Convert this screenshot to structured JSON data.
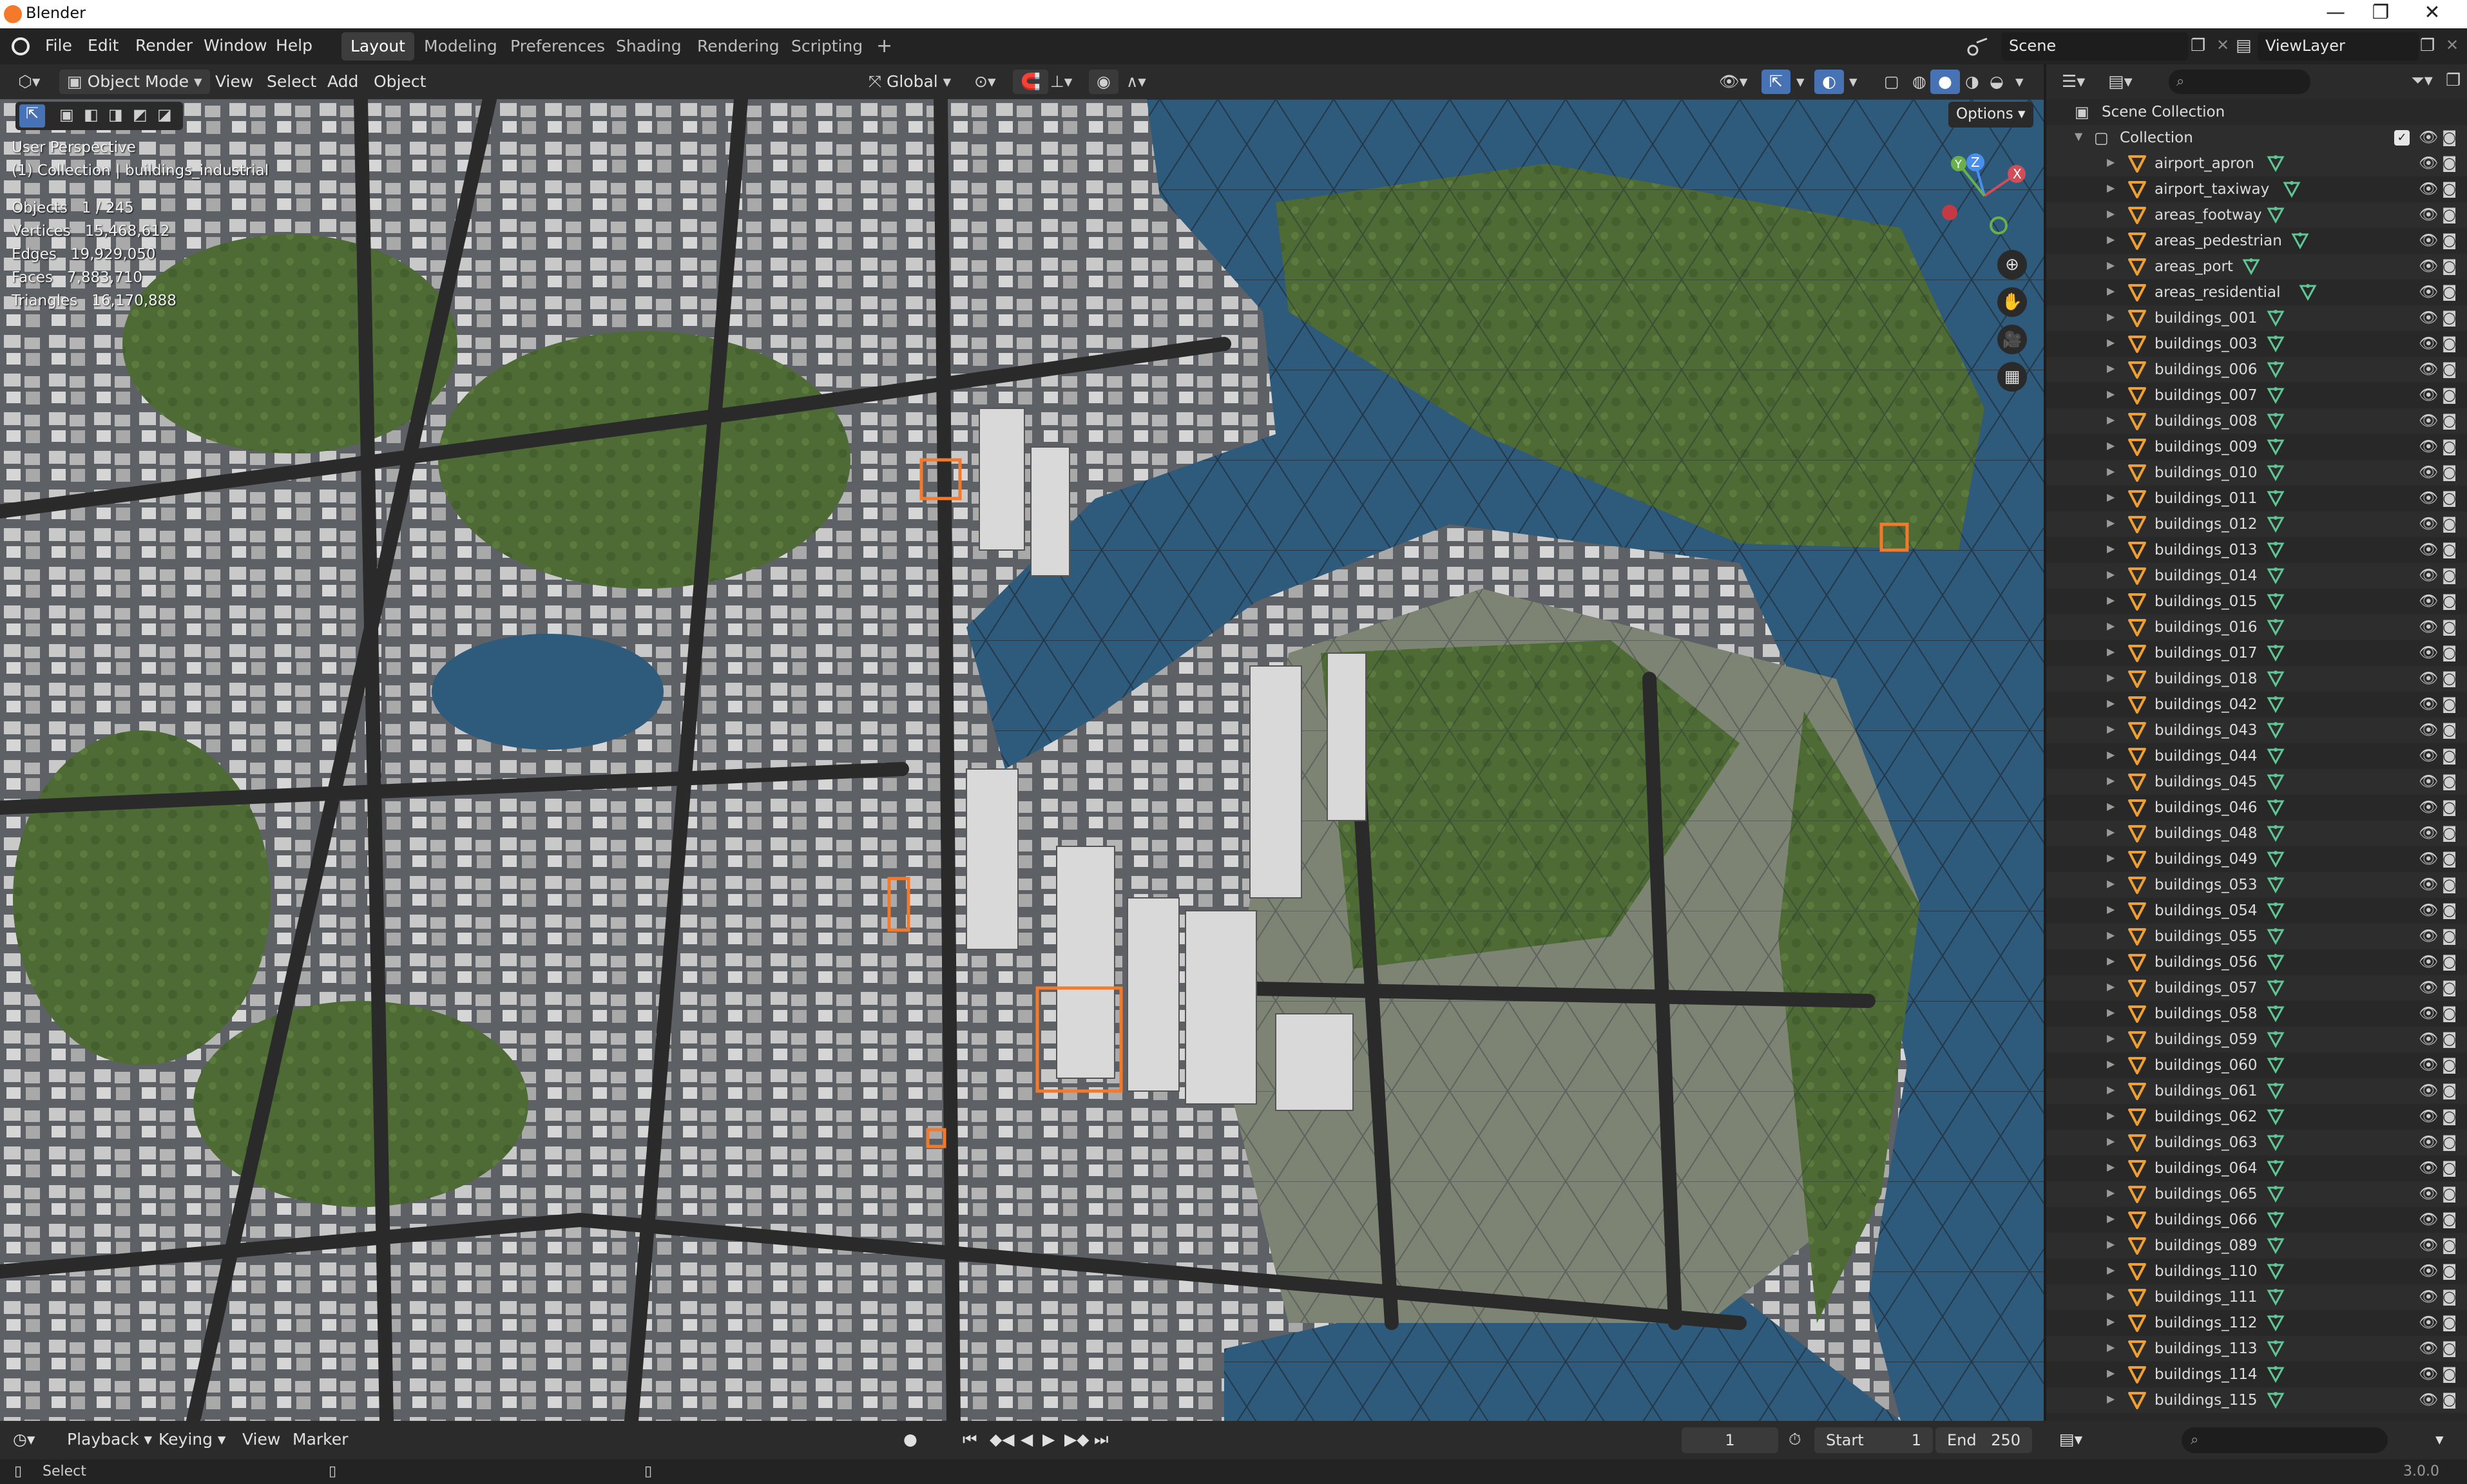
{
  "window": {
    "title": "Blender",
    "minimize": "—",
    "maximize": "❐",
    "close": "✕"
  },
  "menu": [
    "File",
    "Edit",
    "Render",
    "Window",
    "Help"
  ],
  "workspaces": [
    "Layout",
    "Modeling",
    "Preferences",
    "Shading",
    "Rendering",
    "Scripting"
  ],
  "add_workspace": "+",
  "scene": {
    "scene_name": "Scene",
    "view_layer": "ViewLayer"
  },
  "viewport_header": {
    "mode": "Object Mode",
    "items": [
      "View",
      "Select",
      "Add",
      "Object"
    ],
    "orientation": "Global",
    "options": "Options"
  },
  "viewport": {
    "perspective": "User Perspective",
    "context": "(1) Collection | buildings_industrial",
    "stats": [
      {
        "label": "Objects",
        "value": "1 / 245"
      },
      {
        "label": "Vertices",
        "value": "15,468,612"
      },
      {
        "label": "Edges",
        "value": "19,929,050"
      },
      {
        "label": "Faces",
        "value": "7,883,710"
      },
      {
        "label": "Triangles",
        "value": "16,170,888"
      }
    ],
    "gizmo": {
      "x": "X",
      "y": "Y",
      "z": "Z"
    }
  },
  "outliner": {
    "root": "Scene Collection",
    "collection": "Collection",
    "items": [
      "airport_apron",
      "airport_taxiway",
      "areas_footway",
      "areas_pedestrian",
      "areas_port",
      "areas_residential",
      "buildings_001",
      "buildings_003",
      "buildings_006",
      "buildings_007",
      "buildings_008",
      "buildings_009",
      "buildings_010",
      "buildings_011",
      "buildings_012",
      "buildings_013",
      "buildings_014",
      "buildings_015",
      "buildings_016",
      "buildings_017",
      "buildings_018",
      "buildings_042",
      "buildings_043",
      "buildings_044",
      "buildings_045",
      "buildings_046",
      "buildings_048",
      "buildings_049",
      "buildings_053",
      "buildings_054",
      "buildings_055",
      "buildings_056",
      "buildings_057",
      "buildings_058",
      "buildings_059",
      "buildings_060",
      "buildings_061",
      "buildings_062",
      "buildings_063",
      "buildings_064",
      "buildings_065",
      "buildings_066",
      "buildings_089",
      "buildings_110",
      "buildings_111",
      "buildings_112",
      "buildings_113",
      "buildings_114",
      "buildings_115"
    ]
  },
  "timeline": {
    "menus": [
      "Playback",
      "Keying",
      "View",
      "Marker"
    ],
    "current_frame": "1",
    "start_label": "Start",
    "start": "1",
    "end_label": "End",
    "end": "250"
  },
  "status": {
    "action": "Select",
    "version": "3.0.0"
  },
  "colors": {
    "accent": "#4772b3",
    "selection": "#f5792a",
    "mesh_icon": "#f0a030",
    "data_icon": "#5ec794"
  }
}
